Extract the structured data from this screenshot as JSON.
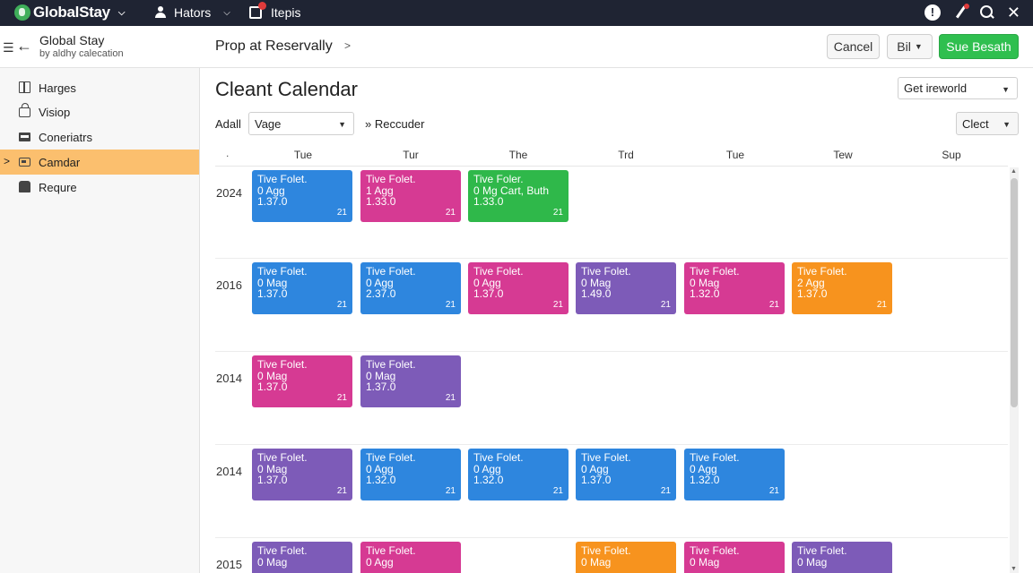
{
  "topbar": {
    "brand": "GlobalStay",
    "nav_hators": "Hators",
    "nav_itepis": "Itepis",
    "info_glyph": "!"
  },
  "header": {
    "app_title": "Global Stay",
    "app_subtitle": "by aldhy calecation",
    "breadcrumb": "Prop at Reservally",
    "cancel_label": "Cancel",
    "bill_label": "Bil",
    "primary_label": "Sue Besath"
  },
  "sidebar": {
    "items": [
      {
        "label": "Harges",
        "icon": "gift-icon"
      },
      {
        "label": "Visiop",
        "icon": "lock-icon"
      },
      {
        "label": "Coneriatrs",
        "icon": "card-icon"
      },
      {
        "label": "Camdar",
        "icon": "calendar-icon",
        "active": true
      },
      {
        "label": "Requre",
        "icon": "bag-icon"
      }
    ]
  },
  "main": {
    "title": "Cleant Calendar",
    "top_select": "Get ireworld",
    "filter_label": "Adall",
    "filter_select": "Vage",
    "reccuder": "Reccuder",
    "clect": "Clect",
    "header_dot": ".",
    "days": [
      "Tue",
      "Tur",
      "The",
      "Trd",
      "Tue",
      "Tew",
      "Sup"
    ]
  },
  "rows": [
    {
      "label": "2024",
      "cards": [
        {
          "col": 0,
          "color": "#2e86de",
          "l1": "Tive Folet.",
          "l2": "0 Agg",
          "l3": "1.37.0",
          "n": "21"
        },
        {
          "col": 1,
          "color": "#d63a93",
          "l1": "Tive Folet.",
          "l2": "1 Agg",
          "l3": "1.33.0",
          "n": "21"
        },
        {
          "col": 2,
          "color": "#2fb84a",
          "l1": "Tive Foler.",
          "l2": "0 Mg Cart, Buth",
          "l3": "1.33.0",
          "n": "21"
        }
      ]
    },
    {
      "label": "2016",
      "cards": [
        {
          "col": 0,
          "color": "#2e86de",
          "l1": "Tive Folet.",
          "l2": "0 Mag",
          "l3": "1.37.0",
          "n": "21"
        },
        {
          "col": 1,
          "color": "#2e86de",
          "l1": "Tive Folet.",
          "l2": "0 Agg",
          "l3": "2.37.0",
          "n": "21"
        },
        {
          "col": 2,
          "color": "#d63a93",
          "l1": "Tive Folet.",
          "l2": "0 Agg",
          "l3": "1.37.0",
          "n": "21"
        },
        {
          "col": 3,
          "color": "#7d5bb8",
          "l1": "Tive Folet.",
          "l2": "0 Mag",
          "l3": "1.49.0",
          "n": "21"
        },
        {
          "col": 4,
          "color": "#d63a93",
          "l1": "Tive Folet.",
          "l2": "0 Mag",
          "l3": "1.32.0",
          "n": "21"
        },
        {
          "col": 5,
          "color": "#f7931e",
          "l1": "Tive Folet.",
          "l2": "2 Agg",
          "l3": "1.37.0",
          "n": "21"
        }
      ]
    },
    {
      "label": "2014",
      "cards": [
        {
          "col": 0,
          "color": "#d63a93",
          "l1": "Tive Folet.",
          "l2": "0 Mag",
          "l3": "1.37.0",
          "n": "21"
        },
        {
          "col": 1,
          "color": "#7d5bb8",
          "l1": "Tive Folet.",
          "l2": "0 Mag",
          "l3": "1.37.0",
          "n": "21"
        }
      ]
    },
    {
      "label": "2014",
      "cards": [
        {
          "col": 0,
          "color": "#7d5bb8",
          "l1": "Tive Folet.",
          "l2": "0 Mag",
          "l3": "1.37.0",
          "n": "21"
        },
        {
          "col": 1,
          "color": "#2e86de",
          "l1": "Tive Folet.",
          "l2": "0 Agg",
          "l3": "1.32.0",
          "n": "21"
        },
        {
          "col": 2,
          "color": "#2e86de",
          "l1": "Tive Folet.",
          "l2": "0 Agg",
          "l3": "1.32.0",
          "n": "21"
        },
        {
          "col": 3,
          "color": "#2e86de",
          "l1": "Tive Folet.",
          "l2": "0 Agg",
          "l3": "1.37.0",
          "n": "21"
        },
        {
          "col": 4,
          "color": "#2e86de",
          "l1": "Tive Folet.",
          "l2": "0 Agg",
          "l3": "1.32.0",
          "n": "21"
        }
      ]
    },
    {
      "label": "2015",
      "cards": [
        {
          "col": 0,
          "color": "#7d5bb8",
          "l1": "Tive Folet.",
          "l2": "0 Mag",
          "l3": "",
          "n": ""
        },
        {
          "col": 1,
          "color": "#d63a93",
          "l1": "Tive Folet.",
          "l2": "0 Agg",
          "l3": "",
          "n": ""
        },
        {
          "col": 3,
          "color": "#f7931e",
          "l1": "Tive Folet.",
          "l2": "0 Mag",
          "l3": "",
          "n": ""
        },
        {
          "col": 4,
          "color": "#d63a93",
          "l1": "Tive Folet.",
          "l2": "0 Mag",
          "l3": "",
          "n": ""
        },
        {
          "col": 5,
          "color": "#7d5bb8",
          "l1": "Tive Folet.",
          "l2": "0 Mag",
          "l3": "",
          "n": ""
        }
      ]
    }
  ]
}
